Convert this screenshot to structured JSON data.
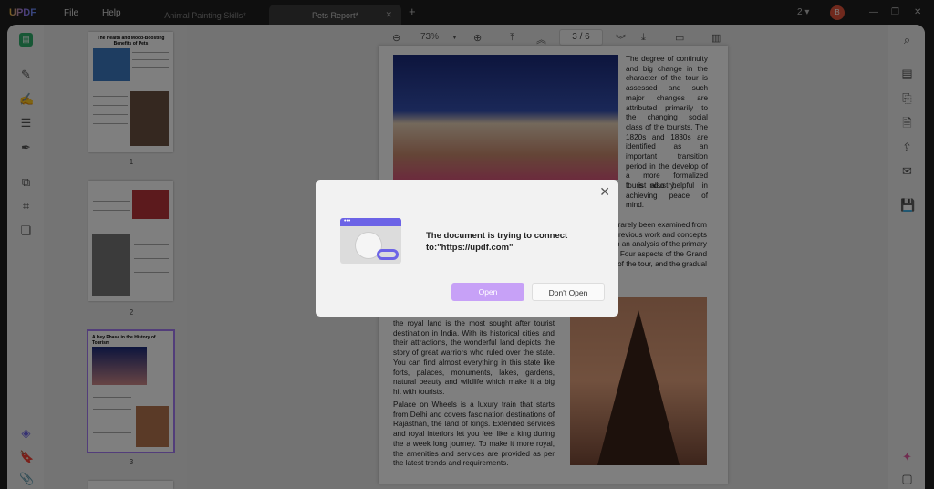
{
  "topbar": {
    "logo": "UPDF",
    "menu": [
      "File",
      "Help"
    ],
    "tabs": [
      {
        "label": "Animal Painting Skills*"
      },
      {
        "label": "Pets Report*"
      }
    ],
    "new_tab": "+",
    "count": "2 ▾",
    "avatar": "B"
  },
  "toolbar": {
    "zoom": "73%",
    "page": "3 / 6"
  },
  "thumbnails": [
    {
      "title": "The Health and Mood-Boosting Benefits of Pets",
      "num": "1"
    },
    {
      "title": "",
      "num": "2"
    },
    {
      "title": "A Key Phase in the History of Tourism",
      "num": "3"
    }
  ],
  "document": {
    "right_col": "The degree of continuity and big change in the character of the tour is assessed and such major changes are attributed primarily to the changing social class of the tourists. The 1820s and 1830s are identified as an important transition period in the develop of a more formalized tourist industry.",
    "right_col2": "It is also helpful in achieving peace of mind.",
    "partial": [
      "s rarely been examined from",
      "previous work and concepts",
      "n an analysis of the primary",
      "s. Four aspects of the Grand",
      "of the tour, and the gradual"
    ],
    "para1": "the royal land is the most sought after tourist destination in India. With its historical cities and their attractions, the wonderful land depicts the story of great warriors who ruled over the state. You can find almost everything in this state like forts, palaces, monuments, lakes, gardens, natural beauty and wildlife which make it a big hit with tourists.",
    "para2": "Palace on Wheels is a luxury train that starts from Delhi and covers fascination destinations of Rajasthan, the land of kings. Extended services and royal interiors let you feel like a king during the a week long journey. To make it more royal, the amenities and services are provided as per the latest trends and requirements."
  },
  "dialog": {
    "message": "The document is trying to connect to:\"https://updf.com\"",
    "open": "Open",
    "dont_open": "Don't Open"
  },
  "colors": {
    "accent": "#a47bf5",
    "dialog_icon": "#6c63e6"
  }
}
